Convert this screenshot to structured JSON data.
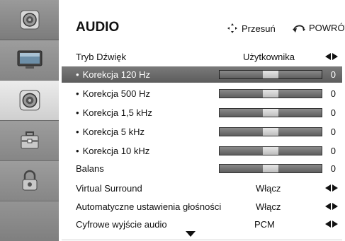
{
  "colors": {
    "selection": "#6a6a6a",
    "sidebar": "#8f8f8f",
    "sidebar_active": "#e2e2e2"
  },
  "sidebar": {
    "items": [
      {
        "icon": "speaker-icon"
      },
      {
        "icon": "tv-picture-icon"
      },
      {
        "icon": "speaker-icon"
      },
      {
        "icon": "toolbox-icon"
      },
      {
        "icon": "padlock-icon"
      }
    ]
  },
  "header": {
    "title": "AUDIO",
    "move_hint": "Przesuń",
    "back_hint": "POWRÓT"
  },
  "menu": {
    "sound_mode": {
      "label": "Tryb Dźwięk",
      "value": "Użytkownika"
    },
    "eq": [
      {
        "label": "Korekcja 120 Hz",
        "value": "0",
        "level": 0
      },
      {
        "label": "Korekcja 500 Hz",
        "value": "0",
        "level": 0
      },
      {
        "label": "Korekcja 1,5 kHz",
        "value": "0",
        "level": 0
      },
      {
        "label": "Korekcja 5 kHz",
        "value": "0",
        "level": 0
      },
      {
        "label": "Korekcja 10 kHz",
        "value": "0",
        "level": 0
      }
    ],
    "balance": {
      "label": "Balans",
      "value": "0",
      "level": 0
    },
    "virtual_surround": {
      "label": "Virtual Surround",
      "value": "Włącz"
    },
    "auto_volume": {
      "label": "Automatyczne ustawienia głośności",
      "value": "Włącz"
    },
    "digital_out": {
      "label": "Cyfrowe wyjście audio",
      "value": "PCM"
    }
  }
}
